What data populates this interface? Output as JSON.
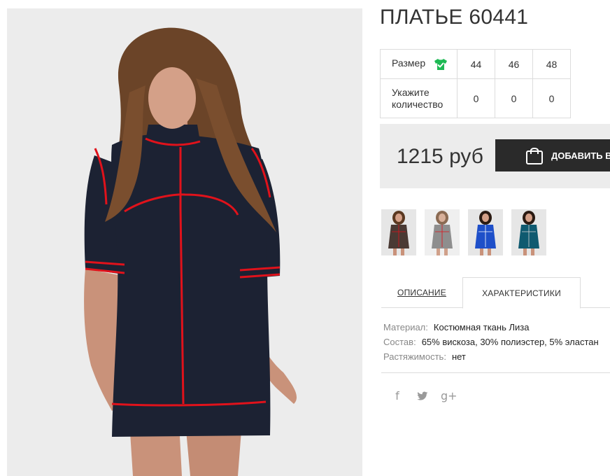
{
  "product": {
    "title": "ПЛАТЬЕ 60441",
    "main_image": "model-in-navy-dress-with-red-piping"
  },
  "size_table": {
    "size_label": "Размер",
    "size_icon": "tshirt-check-icon",
    "qty_label": "Укажите количество",
    "sizes": [
      "44",
      "46",
      "48"
    ],
    "quantities": [
      "0",
      "0",
      "0"
    ]
  },
  "purchase": {
    "price": "1215 руб",
    "add_button_label": "ДОБАВИТЬ В",
    "add_button_icon": "shopping-bag-icon"
  },
  "thumbnails": [
    {
      "color_name": "brown",
      "dress_color": "#4a3a34"
    },
    {
      "color_name": "grey",
      "dress_color": "#8e8e8e"
    },
    {
      "color_name": "blue",
      "dress_color": "#1e4fc9"
    },
    {
      "color_name": "teal",
      "dress_color": "#0f5a70"
    }
  ],
  "tabs": {
    "description": "ОПИСАНИЕ",
    "characteristics": "ХАРАКТЕРИСТИКИ",
    "active": "characteristics"
  },
  "characteristics": [
    {
      "key": "Материал:",
      "value": "Костюмная ткань Лиза"
    },
    {
      "key": "Состав:",
      "value": "65% вискоза, 30% полиэстер, 5% эластан"
    },
    {
      "key": "Растяжимость:",
      "value": "нет"
    }
  ],
  "social": {
    "facebook": "f",
    "twitter": "twitter-bird-icon",
    "googleplus": "g+"
  },
  "colors": {
    "accent_green": "#1db954",
    "button_dark": "#2a2a2a",
    "panel_grey": "#ececec",
    "dress_navy": "#1c2233",
    "piping_red": "#e0121b"
  }
}
